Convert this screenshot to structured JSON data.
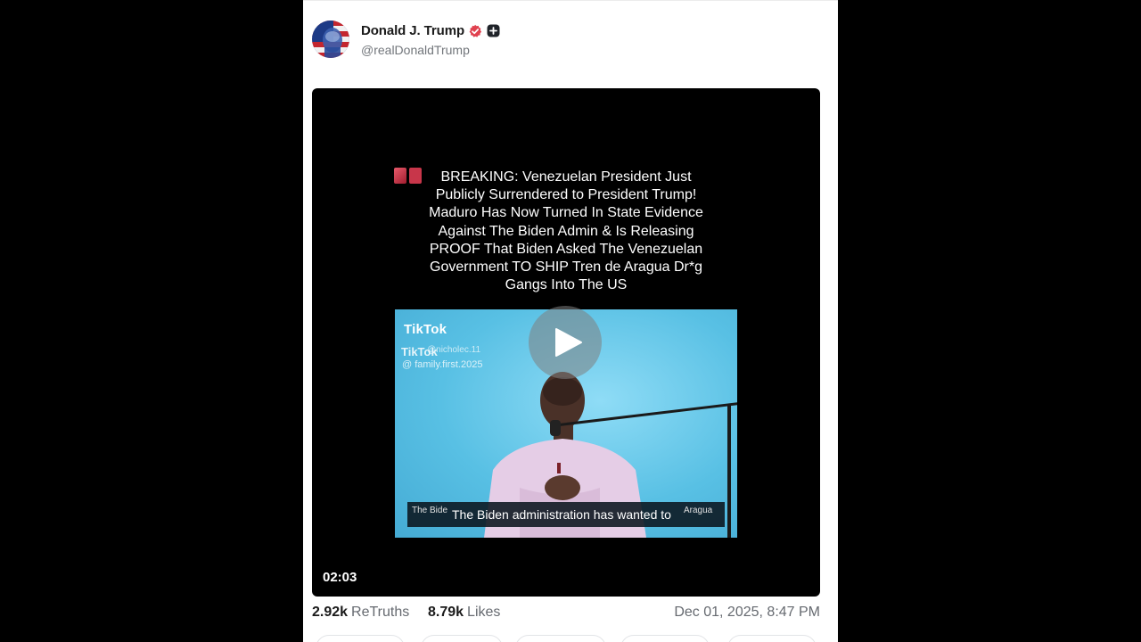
{
  "post": {
    "author": {
      "display_name": "Donald J. Trump",
      "handle": "@realDonaldTrump",
      "verified": true,
      "verified_color": "#e0414f"
    },
    "video": {
      "caption": "BREAKING: Venezuelan President Just\nPublicly Surrendered to President Trump!\nMaduro Has Now Turned In State Evidence\nAgainst The Biden Admin & Is Releasing\nPROOF That Biden Asked The Venezuelan\nGovernment TO SHIP Tren de Aragua Dr*g\nGangs Into The US",
      "inner_clip": {
        "tiktok_logo": "TikTok",
        "tiktok_logo_echo": "TikTok",
        "handle_faint": "@nicholec.11",
        "handle": "@ family.first.2025",
        "subtitle_left": "The Bide",
        "subtitle_main": "The Biden administration has wanted to",
        "subtitle_right": "Aragua"
      },
      "duration": "02:03"
    },
    "stats": {
      "retruths_count": "2.92k",
      "retruths_label": "ReTruths",
      "likes_count": "8.79k",
      "likes_label": "Likes",
      "timestamp": "Dec 01, 2025, 8:47 PM"
    }
  },
  "icons": {
    "verified": "verified-badge-icon",
    "plus": "plus-badge-icon",
    "play": "play-icon"
  }
}
